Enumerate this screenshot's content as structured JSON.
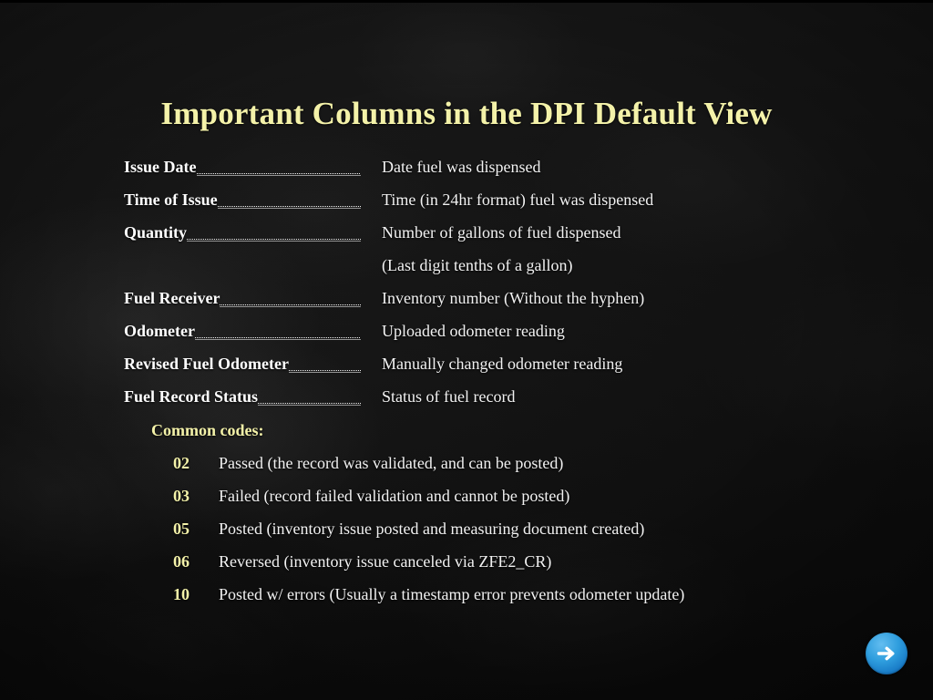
{
  "slide": {
    "title": "Important Columns in the DPI Default View",
    "background_color": "#151515",
    "title_color": "#F4F2A9",
    "body_text_color": "#F2F2F2",
    "accent_color": "#F4F2A9"
  },
  "definitions": [
    {
      "term": "Issue Date",
      "description": "Date fuel was dispensed"
    },
    {
      "term": "Time of Issue",
      "description": "Time (in 24hr format) fuel was dispensed"
    },
    {
      "term": "Quantity",
      "description": "Number of gallons of fuel dispensed"
    },
    {
      "term": "",
      "description": "(Last digit tenths of a gallon)"
    },
    {
      "term": "Fuel Receiver",
      "description": "Inventory number (Without the hyphen)"
    },
    {
      "term": "Odometer",
      "description": "Uploaded odometer reading"
    },
    {
      "term": "Revised Fuel Odometer",
      "description": "Manually changed odometer reading"
    },
    {
      "term": "Fuel Record Status",
      "description": "Status of fuel record"
    }
  ],
  "codes": {
    "heading": "Common codes:",
    "items": [
      {
        "code": "02",
        "description": "Passed (the record was validated, and can be posted)"
      },
      {
        "code": "03",
        "description": "Failed (record failed validation and cannot be posted)"
      },
      {
        "code": "05",
        "description": "Posted (inventory issue posted and measuring document created)"
      },
      {
        "code": "06",
        "description": "Reversed (inventory issue canceled via ZFE2_CR)"
      },
      {
        "code": "10",
        "description": "Posted w/ errors (Usually a timestamp error prevents odometer update)"
      }
    ]
  },
  "navigation": {
    "next_label": "Next slide",
    "next_icon": "arrow-right-icon",
    "button_color": "#2F9EDE"
  }
}
